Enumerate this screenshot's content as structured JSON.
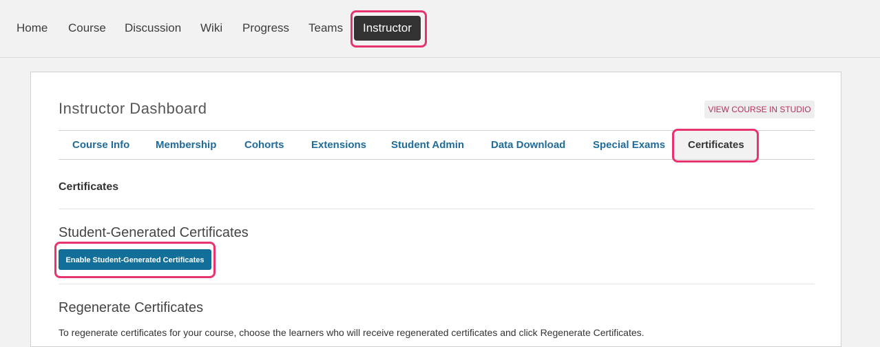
{
  "course_nav": {
    "tabs": [
      {
        "label": "Home"
      },
      {
        "label": "Course"
      },
      {
        "label": "Discussion"
      },
      {
        "label": "Wiki"
      },
      {
        "label": "Progress"
      },
      {
        "label": "Teams"
      },
      {
        "label": "Instructor",
        "active": true
      }
    ]
  },
  "dashboard": {
    "title": "Instructor Dashboard",
    "studio_button_label": "View Course in Studio",
    "tabs": [
      {
        "label": "Course Info"
      },
      {
        "label": "Membership"
      },
      {
        "label": "Cohorts"
      },
      {
        "label": "Extensions"
      },
      {
        "label": "Student Admin"
      },
      {
        "label": "Data Download"
      },
      {
        "label": "Special Exams"
      },
      {
        "label": "Certificates",
        "active": true
      }
    ],
    "section_label": "Certificates",
    "student_generated": {
      "heading": "Student-Generated Certificates",
      "button_label": "Enable Student-Generated Certificates"
    },
    "regenerate": {
      "heading": "Regenerate Certificates",
      "description": "To regenerate certificates for your course, choose the learners who will receive regenerated certificates and click Regenerate Certificates."
    }
  },
  "colors": {
    "highlight": "#e8336d",
    "link_blue": "#1f6b9a",
    "button_blue": "#126f9a",
    "active_nav_bg": "#323232",
    "studio_text": "#b0305c"
  }
}
